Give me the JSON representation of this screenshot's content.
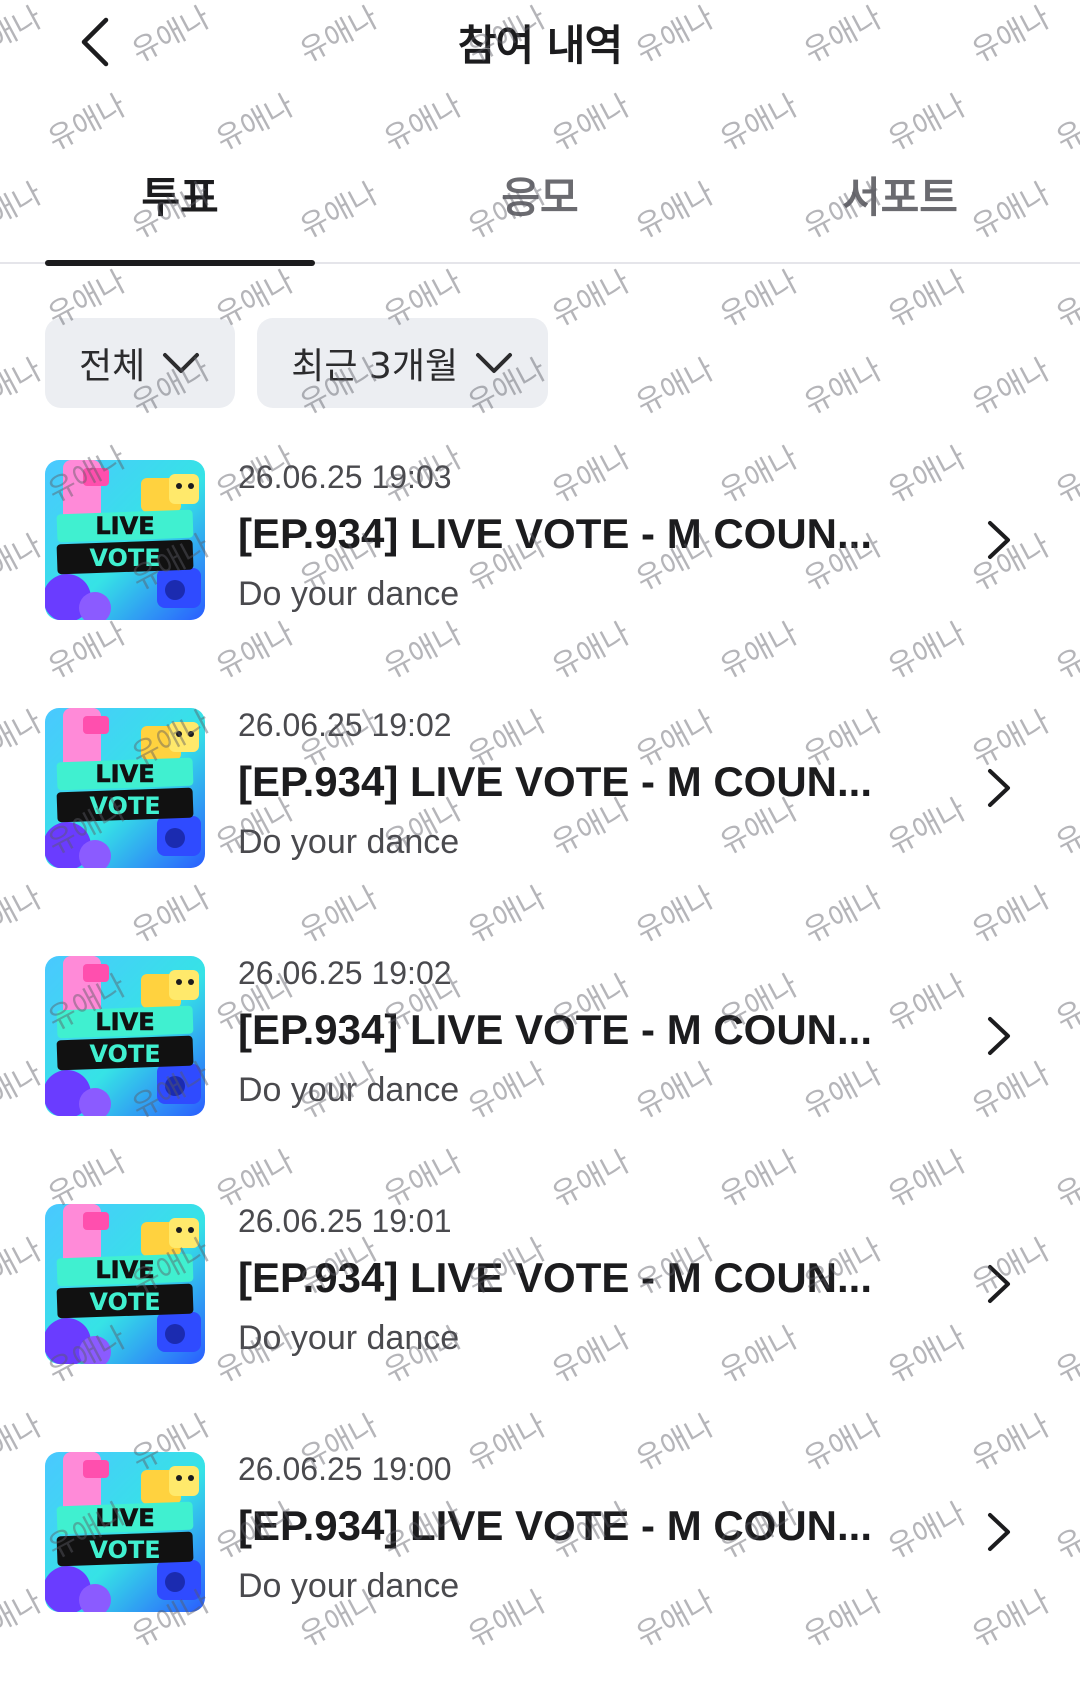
{
  "header": {
    "title": "참여 내역",
    "back_icon": "chevron-left-icon"
  },
  "tabs": [
    {
      "label": "투표",
      "active": true
    },
    {
      "label": "응모",
      "active": false
    },
    {
      "label": "서포트",
      "active": false
    }
  ],
  "filters": [
    {
      "label": "전체",
      "icon": "chevron-down-icon"
    },
    {
      "label": "최근 3개월",
      "icon": "chevron-down-icon"
    }
  ],
  "items": [
    {
      "date": "26.06.25 19:03",
      "title": "[EP.934] LIVE VOTE - M COUN...",
      "subtitle": "Do your dance",
      "thumb_line1": "LIVE",
      "thumb_line2": "VOTE"
    },
    {
      "date": "26.06.25 19:02",
      "title": "[EP.934] LIVE VOTE - M COUN...",
      "subtitle": "Do your dance",
      "thumb_line1": "LIVE",
      "thumb_line2": "VOTE"
    },
    {
      "date": "26.06.25 19:02",
      "title": "[EP.934] LIVE VOTE - M COUN...",
      "subtitle": "Do your dance",
      "thumb_line1": "LIVE",
      "thumb_line2": "VOTE"
    },
    {
      "date": "26.06.25 19:01",
      "title": "[EP.934] LIVE VOTE - M COUN...",
      "subtitle": "Do your dance",
      "thumb_line1": "LIVE",
      "thumb_line2": "VOTE"
    },
    {
      "date": "26.06.25 19:00",
      "title": "[EP.934] LIVE VOTE - M COUN...",
      "subtitle": "Do your dance",
      "thumb_line1": "LIVE",
      "thumb_line2": "VOTE"
    }
  ],
  "watermark": {
    "text": "유애나"
  },
  "colors": {
    "text_primary": "#1c1c1e",
    "text_secondary": "#4a4a4e",
    "chip_bg": "#eceef2",
    "divider": "#e5e5ea",
    "thumb_cyan": "#2ee6e0",
    "thumb_blue": "#2f6bff",
    "thumb_pink": "#ff8ad8",
    "thumb_purple": "#6a3cff",
    "thumb_yellow": "#ffe14d"
  }
}
